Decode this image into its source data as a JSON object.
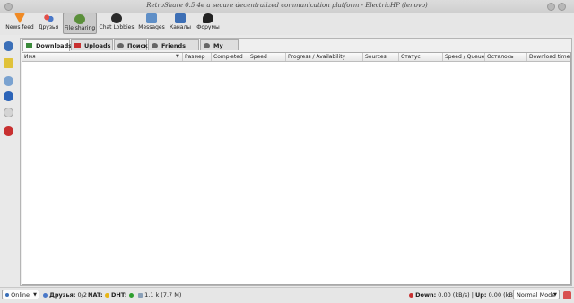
{
  "window": {
    "title": "RetroShare 0.5.4e a secure decentralized communication platform - ElectricHP (lenovo)"
  },
  "toolbar": {
    "items": [
      {
        "label": "News feed",
        "icon": "news-feed-icon",
        "color": "#f08a24"
      },
      {
        "label": "Друзья",
        "icon": "friends-icon",
        "color": "#4a78c8"
      },
      {
        "label": "File sharing",
        "icon": "file-sharing-icon",
        "color": "#5a8f3a",
        "active": true
      },
      {
        "label": "Chat Lobbies",
        "icon": "chat-lobbies-icon",
        "color": "#2b2b2b"
      },
      {
        "label": "Messages",
        "icon": "messages-icon",
        "color": "#5f8fc7"
      },
      {
        "label": "Каналы",
        "icon": "channels-icon",
        "color": "#3d6fb5"
      },
      {
        "label": "Форумы",
        "icon": "forums-icon",
        "color": "#222222"
      }
    ]
  },
  "tabs": [
    {
      "label": "Downloads",
      "icon": "download-icon",
      "active": true
    },
    {
      "label": "Uploads",
      "icon": "upload-icon"
    },
    {
      "label": "Поиск",
      "icon": "search-icon"
    },
    {
      "label": "Friends files",
      "icon": "friends-files-icon"
    },
    {
      "label": "My files",
      "icon": "my-files-icon"
    }
  ],
  "table": {
    "columns": [
      "Имя",
      "Размер",
      "Completed",
      "Speed",
      "Progress / Availability",
      "Sources",
      "Статус",
      "Speed / Queue",
      "Осталось",
      "Download time"
    ]
  },
  "statusbar": {
    "status_select": "Online",
    "friends_label": "Друзья:",
    "friends_value": "0/2",
    "nat_label": "NAT:",
    "dht_label": "DHT:",
    "peers_value": "1.1 k (7.7 M)",
    "down_label": "Down:",
    "down_value": "0.00 (kB/s)",
    "up_label": "Up:",
    "up_value": "0.00 (kB/s)",
    "mode_select": "Normal Mode",
    "colors": {
      "nat": "#e8b516",
      "dht": "#2e9e2e"
    }
  }
}
